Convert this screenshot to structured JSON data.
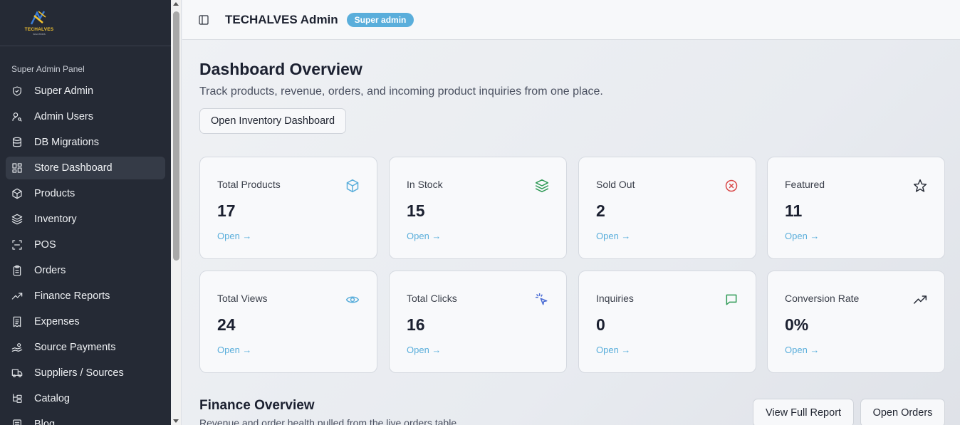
{
  "sidebar": {
    "logo_text": "TECHALVES",
    "logo_sub": "SOLUTIONS",
    "section_label": "Super Admin Panel",
    "items": [
      {
        "label": "Super Admin",
        "icon": "shield-icon"
      },
      {
        "label": "Admin Users",
        "icon": "user-key-icon"
      },
      {
        "label": "DB Migrations",
        "icon": "database-icon"
      },
      {
        "label": "Store Dashboard",
        "icon": "dashboard-grid-icon",
        "active": true
      },
      {
        "label": "Products",
        "icon": "package-icon"
      },
      {
        "label": "Inventory",
        "icon": "layers-icon"
      },
      {
        "label": "POS",
        "icon": "scan-icon"
      },
      {
        "label": "Orders",
        "icon": "clipboard-icon"
      },
      {
        "label": "Finance Reports",
        "icon": "trending-up-icon"
      },
      {
        "label": "Expenses",
        "icon": "receipt-icon"
      },
      {
        "label": "Source Payments",
        "icon": "hand-coins-icon"
      },
      {
        "label": "Suppliers / Sources",
        "icon": "truck-icon"
      },
      {
        "label": "Catalog",
        "icon": "folder-tree-icon"
      },
      {
        "label": "Blog",
        "icon": "newspaper-icon"
      }
    ]
  },
  "header": {
    "title": "TECHALVES Admin",
    "badge": "Super admin"
  },
  "main": {
    "title": "Dashboard Overview",
    "subtitle": "Track products, revenue, orders, and incoming product inquiries from one place.",
    "inventory_button": "Open Inventory Dashboard",
    "cards": [
      {
        "label": "Total Products",
        "value": "17",
        "link": "Open →",
        "icon": "box-icon",
        "icon_color": "#5aaedb"
      },
      {
        "label": "In Stock",
        "value": "15",
        "link": "Open →",
        "icon": "layers-icon",
        "icon_color": "#2f9a56"
      },
      {
        "label": "Sold Out",
        "value": "2",
        "link": "Open →",
        "icon": "x-circle-icon",
        "icon_color": "#d94848"
      },
      {
        "label": "Featured",
        "value": "11",
        "link": "Open →",
        "icon": "star-icon",
        "icon_color": "#2a2f3a"
      },
      {
        "label": "Total Views",
        "value": "24",
        "link": "Open →",
        "icon": "eye-icon",
        "icon_color": "#5aaedb"
      },
      {
        "label": "Total Clicks",
        "value": "16",
        "link": "Open →",
        "icon": "cursor-click-icon",
        "icon_color": "#4a6cd4"
      },
      {
        "label": "Inquiries",
        "value": "0",
        "link": "Open →",
        "icon": "message-icon",
        "icon_color": "#2f9a56"
      },
      {
        "label": "Conversion Rate",
        "value": "0%",
        "link": "Open →",
        "icon": "trending-up-icon",
        "icon_color": "#2a2f3a"
      }
    ],
    "finance": {
      "title": "Finance Overview",
      "subtitle": "Revenue and order health pulled from the live orders table.",
      "report_button": "View Full Report",
      "orders_button": "Open Orders"
    }
  }
}
